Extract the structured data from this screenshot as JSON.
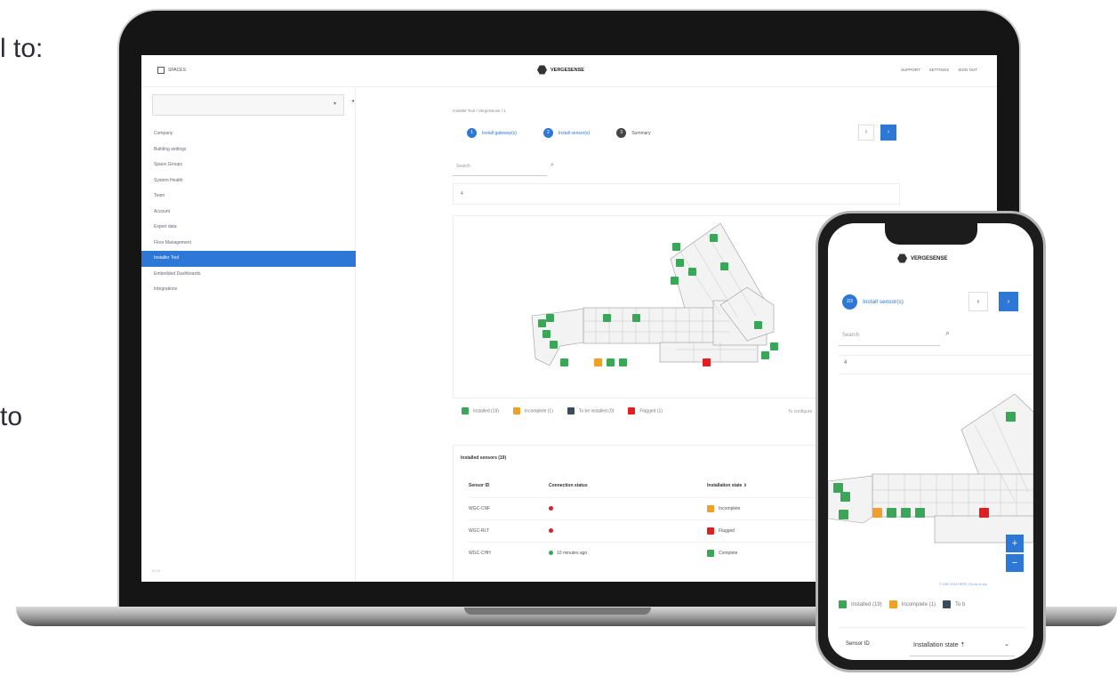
{
  "edge_text": {
    "line1": "l to:",
    "line2": "to"
  },
  "laptop": {
    "top": {
      "spaces_label": "SPACES",
      "logo": "VERGESENSE",
      "nav": [
        "SUPPORT",
        "SETTINGS",
        "SIGN OUT"
      ]
    },
    "sidebar": {
      "dropdown_arrow": "▾",
      "collapse_arrow": "◂",
      "items": [
        {
          "label": "Company",
          "active": false
        },
        {
          "label": "Building settings",
          "active": false
        },
        {
          "label": "Space Groups",
          "active": false
        },
        {
          "label": "System Health",
          "active": false
        },
        {
          "label": "Team",
          "active": false
        },
        {
          "label": "Account",
          "active": false
        },
        {
          "label": "Export data",
          "active": false
        },
        {
          "label": "Floor Management",
          "active": false
        },
        {
          "label": "Installer Tool",
          "active": true
        },
        {
          "label": "Embedded Dashboards",
          "active": false
        },
        {
          "label": "Integrations",
          "active": false
        }
      ],
      "version": "2.0.0"
    },
    "main": {
      "breadcrumb": "Installer Tool / VergeSense / 1",
      "steps": [
        {
          "num": "1",
          "label": "Install gateway(s)",
          "state": "done"
        },
        {
          "num": "2",
          "label": "Install sensor(s)",
          "state": "active"
        },
        {
          "num": "3",
          "label": "Summary",
          "state": "pending"
        }
      ],
      "prev": "‹",
      "next": "›",
      "search_placeholder": "Search",
      "collapse_label": "4",
      "legend": [
        {
          "label": "Installed (19)",
          "color": "#3aa657"
        },
        {
          "label": "Incomplete (1)",
          "color": "#f0a02a"
        },
        {
          "label": "To be installed (0)",
          "color": "#3c4b57"
        },
        {
          "label": "Flagged (1)",
          "color": "#e02020"
        }
      ],
      "legend_extra": "To configure",
      "table": {
        "title": "Installed sensors (19)",
        "headers": [
          "Sensor ID",
          "Connection status",
          "Installation state ⇕"
        ],
        "rows": [
          {
            "id": "WGC-CNF",
            "status": "",
            "status_type": "red",
            "state": "Incomplete",
            "state_color": "#f0a02a"
          },
          {
            "id": "WGC-RLT",
            "status": "",
            "status_type": "red",
            "state": "Flagged",
            "state_color": "#e02020"
          },
          {
            "id": "WGC-CHH",
            "status": "10 minutes ago",
            "status_type": "green",
            "state": "Complete",
            "state_color": "#3aa657"
          }
        ]
      }
    }
  },
  "phone": {
    "logo": "VERGESENSE",
    "step": {
      "num": "2/3",
      "label": "Install sensor(s)"
    },
    "prev": "‹",
    "next": "›",
    "search_placeholder": "Search",
    "collapse_label": "4",
    "zoom_in": "+",
    "zoom_out": "−",
    "attribution": "© 1987-2019 HERE | Terms of use",
    "legend": [
      {
        "label": "Installed (19)",
        "color": "#3aa657"
      },
      {
        "label": "Incomplete (1)",
        "color": "#f0a02a"
      },
      {
        "label": "To b",
        "color": "#3c4b57"
      }
    ],
    "table": {
      "header": "Sensor ID",
      "select": "Installation state ⇡",
      "select_arrow": "⌄"
    }
  }
}
